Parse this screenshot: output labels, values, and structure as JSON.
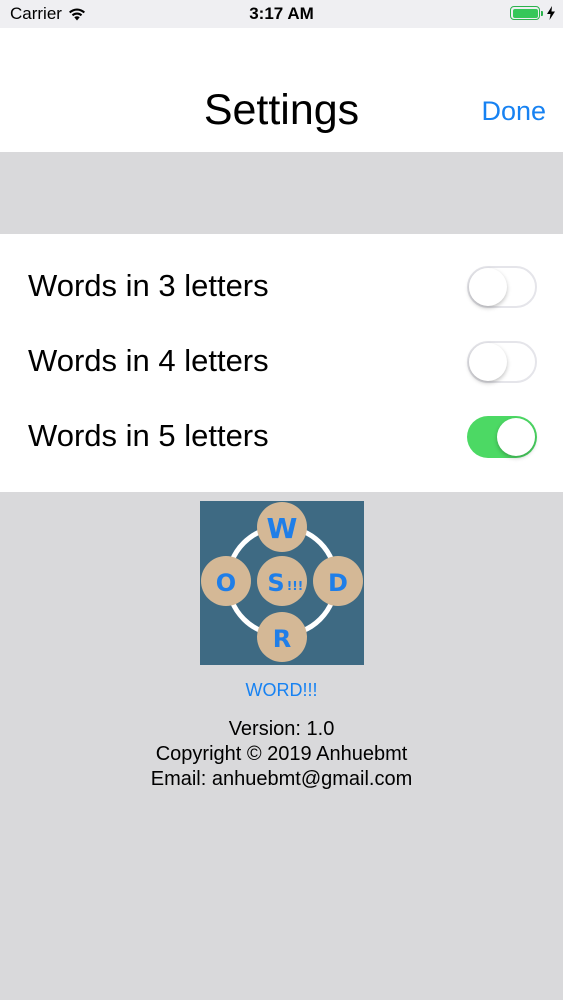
{
  "status_bar": {
    "carrier": "Carrier",
    "time": "3:17 AM",
    "battery_color": "#35c759"
  },
  "nav": {
    "title": "Settings",
    "done_label": "Done",
    "accent_color": "#1782f2"
  },
  "settings": {
    "rows": [
      {
        "label": "Words in 3 letters",
        "enabled": false
      },
      {
        "label": "Words in 4 letters",
        "enabled": false
      },
      {
        "label": "Words in 5 letters",
        "enabled": true
      }
    ],
    "toggle_on_color": "#4cd964"
  },
  "about": {
    "logo_letters": {
      "top": "W",
      "left": "O",
      "center": "S",
      "right": "D",
      "bottom": "R"
    },
    "app_name": "WORD!!!",
    "version": "Version: 1.0",
    "copyright": "Copyright © 2019 Anhuebmt",
    "email": "Email: anhuebmt@gmail.com"
  }
}
